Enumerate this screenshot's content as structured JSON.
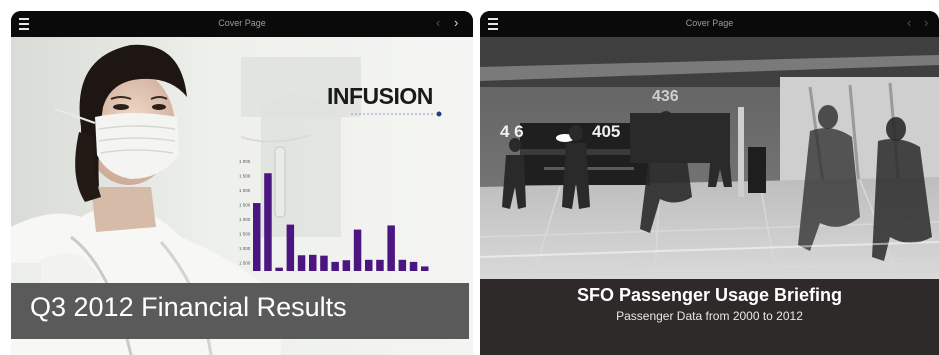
{
  "slides": [
    {
      "header": {
        "title": "Cover Page"
      },
      "logo": {
        "text": "INFUSION"
      },
      "title": "Q3 2012  Financial Results",
      "chart_data": {
        "type": "bar",
        "values": [
          820,
          1180,
          40,
          560,
          190,
          195,
          185,
          110,
          130,
          500,
          135,
          135,
          550,
          135,
          110,
          55
        ],
        "y_ticks": [
          "1 000",
          "1 500",
          "1 000",
          "1 500",
          "1 000",
          "1 500",
          "1 000",
          "1 500"
        ],
        "ylim": [
          0,
          1400
        ],
        "colors": {
          "bar": "#4b1680"
        }
      }
    },
    {
      "header": {
        "title": "Cover Page"
      },
      "photo": {
        "gate_left": "4 6",
        "gate_right": "405",
        "sign_top": "436"
      },
      "title": "SFO Passenger Usage Briefing",
      "subtitle": "Passenger Data from 2000 to 2012"
    }
  ]
}
